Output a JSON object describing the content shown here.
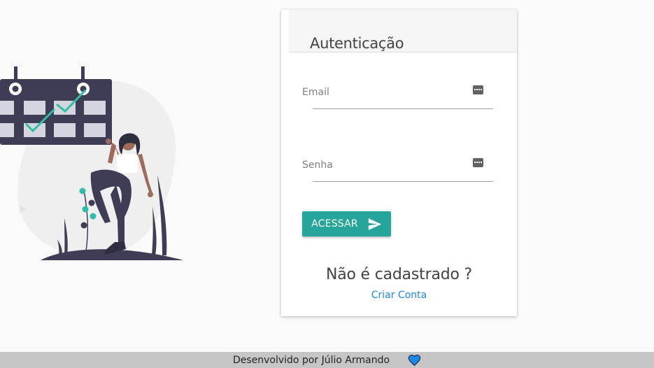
{
  "login": {
    "title": "Autenticação",
    "email": {
      "label": "Email",
      "value": ""
    },
    "password": {
      "label": "Senha",
      "value": ""
    },
    "submit_label": "ACESSAR",
    "register_question": "Não é cadastrado ?",
    "register_link": "Criar Conta"
  },
  "footer": {
    "text": "Desenvolvido por Júlio Armando"
  },
  "icons": {
    "field_icon": "keyboard-icon",
    "submit_icon": "send-icon",
    "footer_icon": "heart-icon"
  },
  "colors": {
    "accent": "#26a69a",
    "link": "#1e88e5",
    "heart": "#1e88e5",
    "footer_bg": "#c6c6c6"
  }
}
